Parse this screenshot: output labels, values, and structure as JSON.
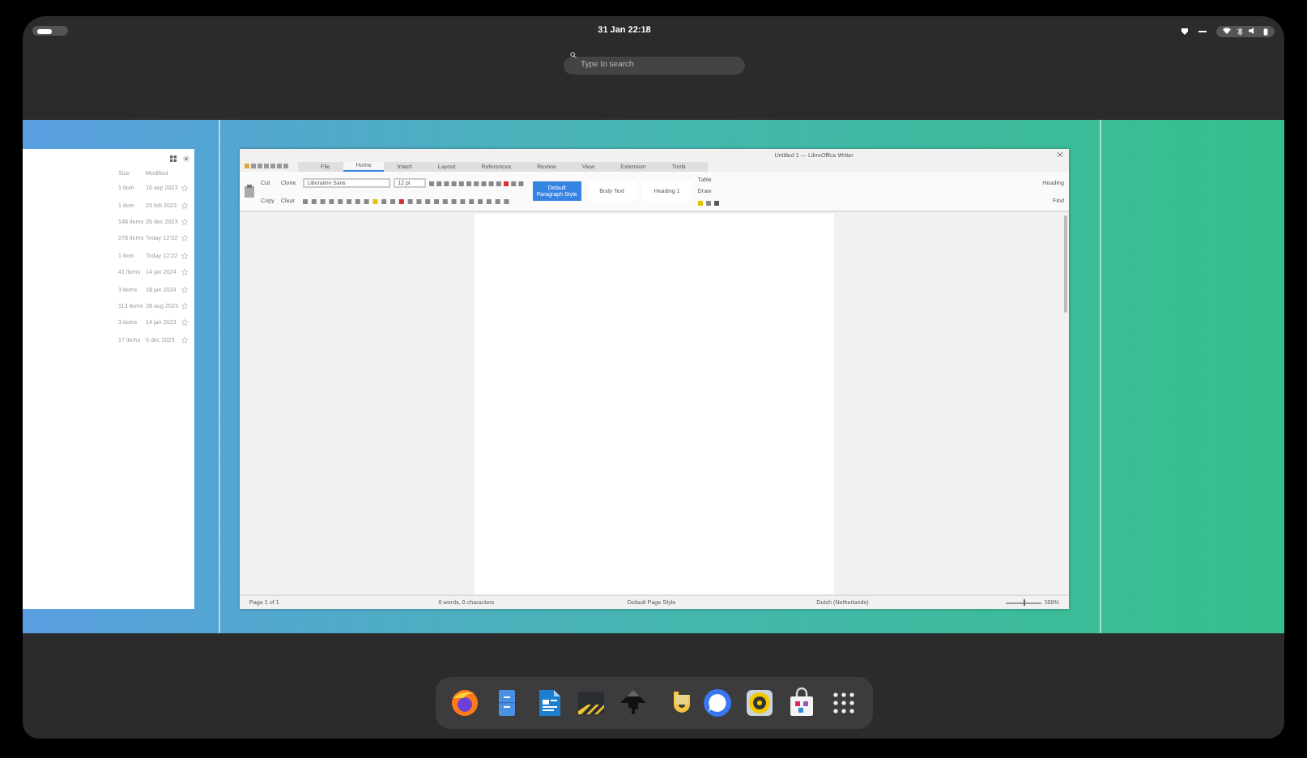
{
  "top_bar": {
    "clock": "31 Jan  22:18"
  },
  "search": {
    "placeholder": "Type to search"
  },
  "files_window": {
    "columns": [
      "Size",
      "Modified"
    ],
    "rows": [
      {
        "size": "1 item",
        "modified": "10 sep 2023",
        "starred": false
      },
      {
        "size": "1 item",
        "modified": "23 feb 2023",
        "starred": false
      },
      {
        "size": "148 items",
        "modified": "25 dec 2023",
        "starred": false
      },
      {
        "size": "278 items",
        "modified": "Today 12:52",
        "starred": false
      },
      {
        "size": "1 item",
        "modified": "Today 12:22",
        "starred": false
      },
      {
        "size": "41 items",
        "modified": "14 jan 2024",
        "starred": false
      },
      {
        "size": "3 items",
        "modified": "18 jan 2024",
        "starred": false
      },
      {
        "size": "113 items",
        "modified": "28 aug 2023",
        "starred": false
      },
      {
        "size": "3 items",
        "modified": "14 jan 2023",
        "starred": false
      },
      {
        "size": "17 items",
        "modified": "6 dec 2023",
        "starred": false
      }
    ]
  },
  "writer_window": {
    "title": "Untitled 1 — LibreOffice Writer",
    "tabs": [
      {
        "label": "File",
        "selected": false
      },
      {
        "label": "Home",
        "selected": true
      },
      {
        "label": "Insert",
        "selected": false
      },
      {
        "label": "Layout",
        "selected": false
      },
      {
        "label": "References",
        "selected": false
      },
      {
        "label": "Review",
        "selected": false
      },
      {
        "label": "View",
        "selected": false
      },
      {
        "label": "Extension",
        "selected": false
      },
      {
        "label": "Tools",
        "selected": false
      }
    ],
    "clipboard": [
      "Cut",
      "Copy",
      "Clone",
      "Clear"
    ],
    "font_name": "Liberation Sans",
    "font_size": "12 pt",
    "styles": [
      {
        "label": "Default Paragraph Style",
        "selected": true
      },
      {
        "label": "Body Text",
        "selected": false
      },
      {
        "label": "Heading 1",
        "selected": false
      }
    ],
    "tools": [
      "Table",
      "Draw"
    ],
    "right_tools": [
      "Heading",
      "Find"
    ],
    "status_bar": [
      "Page 1 of 1",
      "0 words, 0 characters",
      "Default Page Style",
      "Dutch (Netherlands)"
    ],
    "zoom_slider": {
      "level": 0.5
    },
    "zoom": "100%"
  }
}
